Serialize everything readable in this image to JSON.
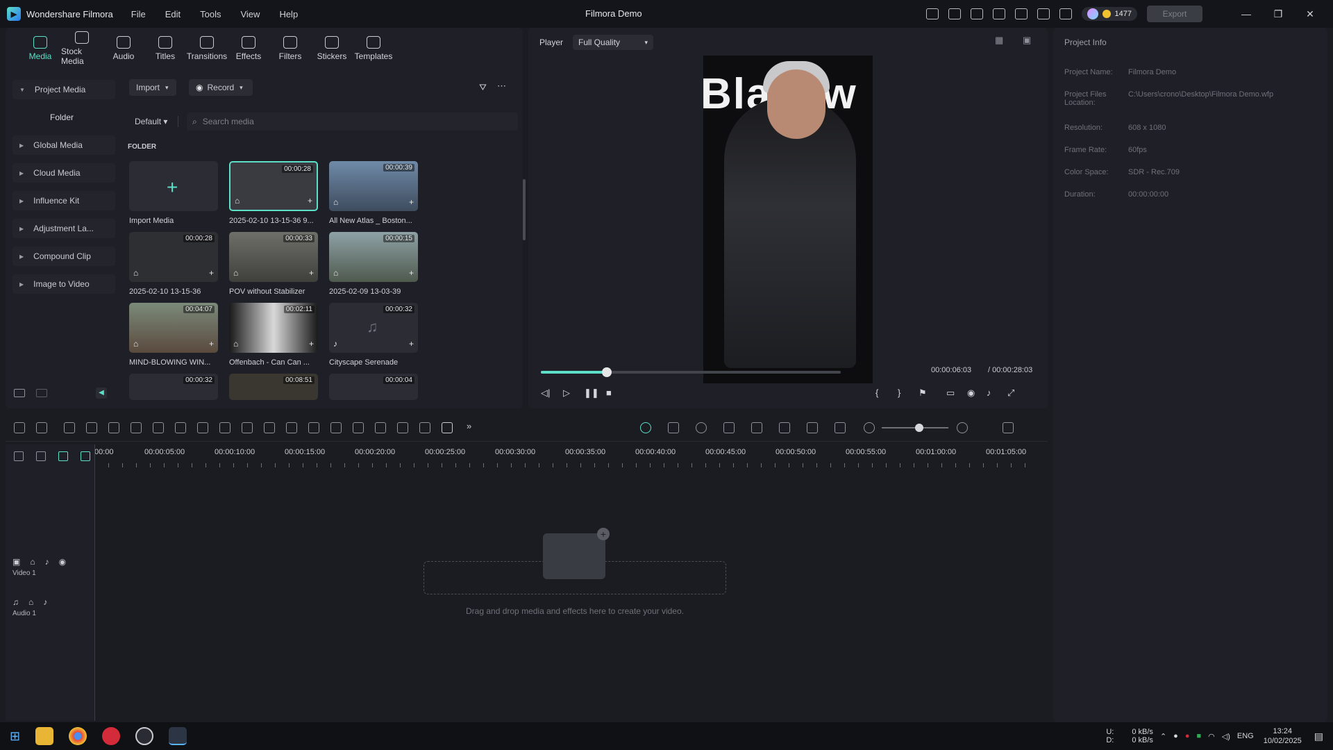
{
  "app": {
    "name": "Wondershare Filmora",
    "project_title": "Filmora Demo"
  },
  "menu": [
    "File",
    "Edit",
    "Tools",
    "View",
    "Help"
  ],
  "credits": "1477",
  "export_label": "Export",
  "toolbar": [
    {
      "label": "Media",
      "icon": "media-icon",
      "active": true
    },
    {
      "label": "Stock Media",
      "icon": "stock-media-icon"
    },
    {
      "label": "Audio",
      "icon": "audio-icon"
    },
    {
      "label": "Titles",
      "icon": "titles-icon"
    },
    {
      "label": "Transitions",
      "icon": "transitions-icon"
    },
    {
      "label": "Effects",
      "icon": "effects-icon"
    },
    {
      "label": "Filters",
      "icon": "filters-icon"
    },
    {
      "label": "Stickers",
      "icon": "stickers-icon"
    },
    {
      "label": "Templates",
      "icon": "templates-icon"
    }
  ],
  "sidebar": [
    {
      "label": "Project Media"
    },
    {
      "label": "Folder"
    },
    {
      "label": "Global Media"
    },
    {
      "label": "Cloud Media"
    },
    {
      "label": "Influence Kit"
    },
    {
      "label": "Adjustment La..."
    },
    {
      "label": "Compound Clip"
    },
    {
      "label": "Image to Video"
    }
  ],
  "media_top": {
    "import": "Import",
    "record": "Record"
  },
  "search": {
    "sort": "Default",
    "placeholder": "Search media"
  },
  "folder_label": "FOLDER",
  "tiles": [
    {
      "caption": "Import Media",
      "duration": ""
    },
    {
      "caption": "2025-02-10 13-15-36 9...",
      "duration": "00:00:28"
    },
    {
      "caption": "All New Atlas _ Boston...",
      "duration": "00:00:39"
    },
    {
      "caption": "2025-02-10 13-15-36",
      "duration": "00:00:28"
    },
    {
      "caption": "POV without Stabilizer",
      "duration": "00:00:33"
    },
    {
      "caption": "2025-02-09 13-03-39",
      "duration": "00:00:15"
    },
    {
      "caption": "MIND-BLOWING WIN...",
      "duration": "00:04:07"
    },
    {
      "caption": "Offenbach - Can Can ...",
      "duration": "00:02:11"
    },
    {
      "caption": "Cityscape Serenade",
      "duration": "00:00:32"
    },
    {
      "caption": "",
      "duration": "00:00:32"
    },
    {
      "caption": "",
      "duration": "00:08:51"
    },
    {
      "caption": "",
      "duration": "00:00:04"
    }
  ],
  "player": {
    "label": "Player",
    "quality": "Full Quality",
    "current": "00:00:06:03",
    "total": "/ 00:00:28:03",
    "progress": 0.22,
    "video_text": "Blackw"
  },
  "project_info": {
    "title": "Project Info",
    "rows": [
      {
        "k": "Project Name:",
        "v": "Filmora Demo"
      },
      {
        "k": "Project Files Location:",
        "v": "C:\\Users\\crono\\Desktop\\Filmora Demo.wfp"
      },
      {
        "k": "Resolution:",
        "v": "608 x 1080"
      },
      {
        "k": "Frame Rate:",
        "v": "60fps"
      },
      {
        "k": "Color Space:",
        "v": "SDR - Rec.709"
      },
      {
        "k": "Duration:",
        "v": "00:00:00:00"
      }
    ]
  },
  "ruler": [
    "00:00",
    "00:00:05:00",
    "00:00:10:00",
    "00:00:15:00",
    "00:00:20:00",
    "00:00:25:00",
    "00:00:30:00",
    "00:00:35:00",
    "00:00:40:00",
    "00:00:45:00",
    "00:00:50:00",
    "00:00:55:00",
    "00:01:00:00",
    "00:01:05:00"
  ],
  "tracks": [
    {
      "label": "Video 1"
    },
    {
      "label": "Audio 1"
    }
  ],
  "drop_text": "Drag and drop media and effects here to create your video.",
  "taskbar": {
    "net_up": "0 kB/s",
    "net_down": "0 kB/s",
    "lang": "ENG",
    "time": "13:24",
    "date": "10/02/2025",
    "drive_u": "U:",
    "drive_d": "D:"
  }
}
